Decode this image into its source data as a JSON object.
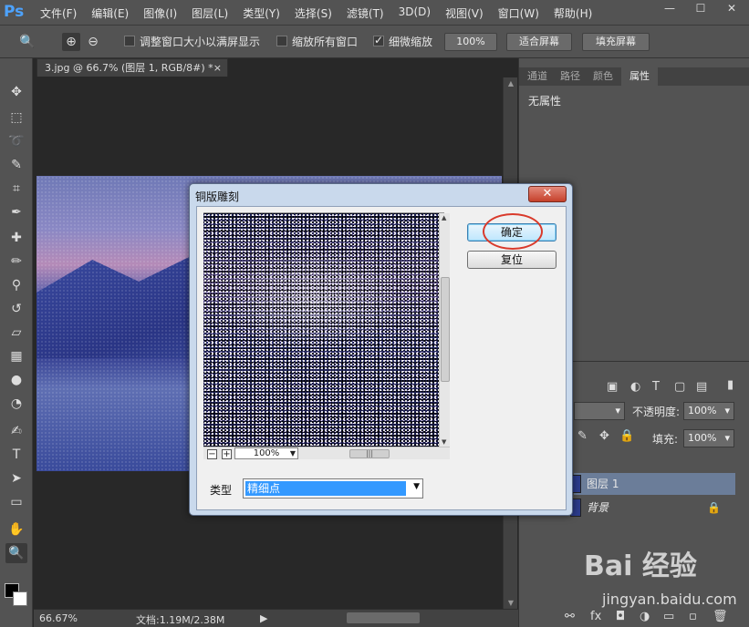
{
  "app": {
    "logo": "Ps"
  },
  "menu": [
    "文件(F)",
    "编辑(E)",
    "图像(I)",
    "图层(L)",
    "类型(Y)",
    "选择(S)",
    "滤镜(T)",
    "3D(D)",
    "视图(V)",
    "窗口(W)",
    "帮助(H)"
  ],
  "window_controls": {
    "minimize": "—",
    "maximize": "☐",
    "close": "✕"
  },
  "options": {
    "resize_label": "调整窗口大小以满屏显示",
    "resize_checked": false,
    "zoom_all_label": "缩放所有窗口",
    "zoom_all_checked": false,
    "scrubby_label": "细微缩放",
    "scrubby_checked": true,
    "zoom_100": "100%",
    "fit_screen": "适合屏幕",
    "fill_screen": "填充屏幕"
  },
  "document": {
    "tab_title": "3.jpg @ 66.7% (图层 1, RGB/8#) *",
    "tab_close": "×",
    "zoom": "66.67%",
    "doc_info": "文档:1.19M/2.38M"
  },
  "panels": {
    "tabs": [
      "通道",
      "路径",
      "颜色",
      "属性"
    ],
    "active_tab": "属性",
    "no_properties": "无属性"
  },
  "layers": {
    "opacity_label": "不透明度:",
    "opacity_value": "100%",
    "fill_label": "填充:",
    "fill_value": "100%",
    "items": [
      {
        "name": "图层 1",
        "selected": true
      },
      {
        "name": "背景",
        "selected": false,
        "locked": true
      }
    ]
  },
  "dialog": {
    "title": "铜版雕刻",
    "close": "✕",
    "ok": "确定",
    "reset": "复位",
    "zoom_value": "100%",
    "type_label": "类型",
    "type_value": "精细点"
  },
  "watermark": {
    "logo": "Bai 经验",
    "url": "jingyan.baidu.com"
  }
}
